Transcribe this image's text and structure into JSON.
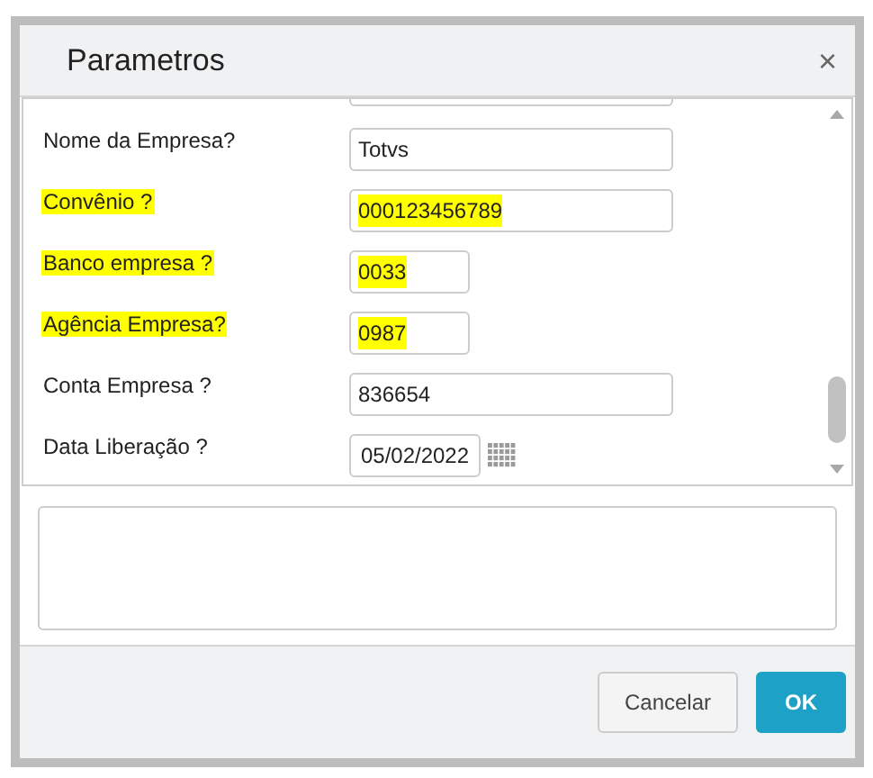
{
  "dialog": {
    "title": "Parametros",
    "close": "×"
  },
  "fields": [
    {
      "label": "Nome da Empresa?",
      "value": "Totvs",
      "kind": "text",
      "highlighted": false
    },
    {
      "label": "Convênio ?",
      "value": "000123456789",
      "kind": "text",
      "highlighted": true
    },
    {
      "label": "Banco empresa ?",
      "value": "0033",
      "kind": "short",
      "highlighted": true
    },
    {
      "label": "Agência Empresa?",
      "value": "0987",
      "kind": "short",
      "highlighted": true
    },
    {
      "label": "Conta Empresa ?",
      "value": "836654",
      "kind": "text",
      "highlighted": false
    },
    {
      "label": "Data Liberação ?",
      "value": "05/02/2022",
      "kind": "date",
      "highlighted": false
    }
  ],
  "buttons": [
    {
      "label": "Cancelar",
      "kind": "secondary"
    },
    {
      "label": "OK",
      "kind": "primary"
    }
  ]
}
